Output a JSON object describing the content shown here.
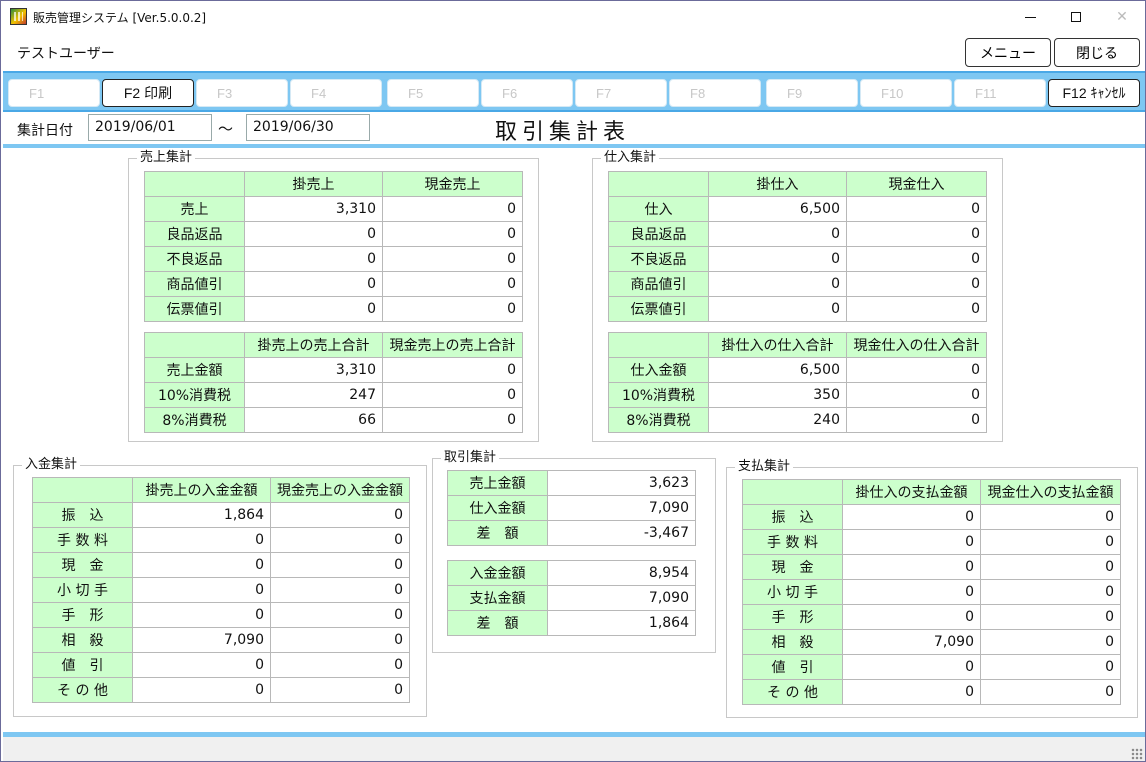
{
  "window": {
    "title": "販売管理システム [Ver.5.0.0.2]",
    "icon": "app-logo-icon"
  },
  "user": {
    "name": "テストユーザー"
  },
  "top_buttons": {
    "menu": "メニュー",
    "close": "閉じる"
  },
  "fkeys": [
    {
      "label": "F1",
      "enabled": false
    },
    {
      "label": "F2 印刷",
      "enabled": true
    },
    {
      "label": "F3",
      "enabled": false
    },
    {
      "label": "F4",
      "enabled": false
    },
    {
      "label": "F5",
      "enabled": false
    },
    {
      "label": "F6",
      "enabled": false
    },
    {
      "label": "F7",
      "enabled": false
    },
    {
      "label": "F8",
      "enabled": false
    },
    {
      "label": "F9",
      "enabled": false
    },
    {
      "label": "F10",
      "enabled": false
    },
    {
      "label": "F11",
      "enabled": false
    },
    {
      "label": "F12 ｷｬﾝｾﾙ",
      "enabled": true
    }
  ],
  "period": {
    "label": "集計日付",
    "from": "2019/06/01",
    "tilde": "～",
    "to": "2019/06/30"
  },
  "report_title": "取引集計表",
  "colors": {
    "header_bg": "#ccffcc",
    "accent_bar": "#7ec7f2"
  },
  "sales": {
    "title": "売上集計",
    "t1": {
      "headers": [
        "掛売上",
        "現金売上"
      ],
      "rows": [
        {
          "label": "売上",
          "values": [
            "3,310",
            "0"
          ]
        },
        {
          "label": "良品返品",
          "values": [
            "0",
            "0"
          ]
        },
        {
          "label": "不良返品",
          "values": [
            "0",
            "0"
          ]
        },
        {
          "label": "商品値引",
          "values": [
            "0",
            "0"
          ]
        },
        {
          "label": "伝票値引",
          "values": [
            "0",
            "0"
          ]
        }
      ]
    },
    "t2": {
      "headers": [
        "掛売上の売上合計",
        "現金売上の売上合計"
      ],
      "rows": [
        {
          "label": "売上金額",
          "values": [
            "3,310",
            "0"
          ]
        },
        {
          "label": "10%消費税",
          "values": [
            "247",
            "0"
          ]
        },
        {
          "label": "8%消費税",
          "values": [
            "66",
            "0"
          ]
        }
      ]
    }
  },
  "purchase": {
    "title": "仕入集計",
    "t1": {
      "headers": [
        "掛仕入",
        "現金仕入"
      ],
      "rows": [
        {
          "label": "仕入",
          "values": [
            "6,500",
            "0"
          ]
        },
        {
          "label": "良品返品",
          "values": [
            "0",
            "0"
          ]
        },
        {
          "label": "不良返品",
          "values": [
            "0",
            "0"
          ]
        },
        {
          "label": "商品値引",
          "values": [
            "0",
            "0"
          ]
        },
        {
          "label": "伝票値引",
          "values": [
            "0",
            "0"
          ]
        }
      ]
    },
    "t2": {
      "headers": [
        "掛仕入の仕入合計",
        "現金仕入の仕入合計"
      ],
      "rows": [
        {
          "label": "仕入金額",
          "values": [
            "6,500",
            "0"
          ]
        },
        {
          "label": "10%消費税",
          "values": [
            "350",
            "0"
          ]
        },
        {
          "label": "8%消費税",
          "values": [
            "240",
            "0"
          ]
        }
      ]
    }
  },
  "receipt": {
    "title": "入金集計",
    "headers": [
      "掛売上の入金金額",
      "現金売上の入金金額"
    ],
    "rows": [
      {
        "label": "振　込",
        "values": [
          "1,864",
          "0"
        ]
      },
      {
        "label": "手 数 料",
        "values": [
          "0",
          "0"
        ]
      },
      {
        "label": "現　金",
        "values": [
          "0",
          "0"
        ]
      },
      {
        "label": "小 切 手",
        "values": [
          "0",
          "0"
        ]
      },
      {
        "label": "手　形",
        "values": [
          "0",
          "0"
        ]
      },
      {
        "label": "相　殺",
        "values": [
          "7,090",
          "0"
        ]
      },
      {
        "label": "値　引",
        "values": [
          "0",
          "0"
        ]
      },
      {
        "label": "そ の 他",
        "values": [
          "0",
          "0"
        ]
      }
    ]
  },
  "transaction": {
    "title": "取引集計",
    "t1": [
      {
        "label": "売上金額",
        "value": "3,623"
      },
      {
        "label": "仕入金額",
        "value": "7,090"
      },
      {
        "label": "差　額",
        "value": "-3,467"
      }
    ],
    "t2": [
      {
        "label": "入金金額",
        "value": "8,954"
      },
      {
        "label": "支払金額",
        "value": "7,090"
      },
      {
        "label": "差　額",
        "value": "1,864"
      }
    ]
  },
  "payment": {
    "title": "支払集計",
    "headers": [
      "掛仕入の支払金額",
      "現金仕入の支払金額"
    ],
    "rows": [
      {
        "label": "振　込",
        "values": [
          "0",
          "0"
        ]
      },
      {
        "label": "手 数 料",
        "values": [
          "0",
          "0"
        ]
      },
      {
        "label": "現　金",
        "values": [
          "0",
          "0"
        ]
      },
      {
        "label": "小 切 手",
        "values": [
          "0",
          "0"
        ]
      },
      {
        "label": "手　形",
        "values": [
          "0",
          "0"
        ]
      },
      {
        "label": "相　殺",
        "values": [
          "7,090",
          "0"
        ]
      },
      {
        "label": "値　引",
        "values": [
          "0",
          "0"
        ]
      },
      {
        "label": "そ の 他",
        "values": [
          "0",
          "0"
        ]
      }
    ]
  }
}
